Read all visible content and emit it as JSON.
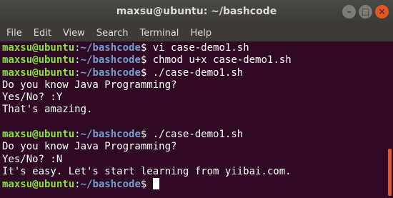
{
  "window": {
    "title": "maxsu@ubuntu: ~/bashcode"
  },
  "menu": [
    "File",
    "Edit",
    "View",
    "Search",
    "Terminal",
    "Help"
  ],
  "prompt": {
    "user_host": "maxsu@ubuntu",
    "sep": ":",
    "path": "~/bashcode",
    "symbol": "$"
  },
  "lines": [
    {
      "type": "cmd",
      "text": " vi case-demo1.sh"
    },
    {
      "type": "cmd",
      "text": " chmod u+x case-demo1.sh"
    },
    {
      "type": "cmd",
      "text": " ./case-demo1.sh"
    },
    {
      "type": "out",
      "text": "Do you know Java Programming?"
    },
    {
      "type": "out",
      "text": "Yes/No? :Y"
    },
    {
      "type": "out",
      "text": "That's amazing."
    },
    {
      "type": "out",
      "text": ""
    },
    {
      "type": "cmd",
      "text": " ./case-demo1.sh"
    },
    {
      "type": "out",
      "text": "Do you know Java Programming?"
    },
    {
      "type": "out",
      "text": "Yes/No? :N"
    },
    {
      "type": "out",
      "text": "It's easy. Let's start learning from yiibai.com."
    },
    {
      "type": "prompt",
      "text": " "
    }
  ],
  "colors": {
    "background": "#300a24",
    "user_host": "#8ae234",
    "path": "#729fcf",
    "scrollbar": "#e95420"
  }
}
